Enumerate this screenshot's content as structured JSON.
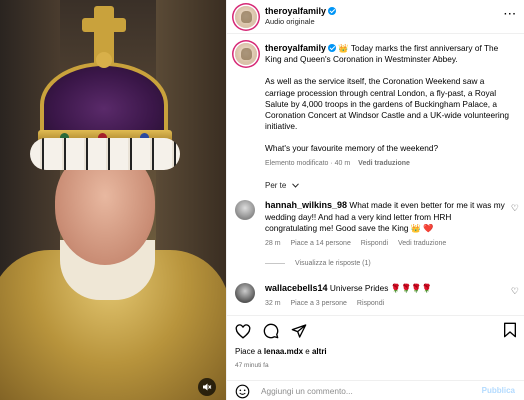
{
  "header": {
    "username": "theroyalfamily",
    "audio_label": "Audio originale",
    "more_icon": "more-horizontal-icon"
  },
  "caption": {
    "username": "theroyalfamily",
    "emoji": "👑",
    "text1": "Today marks the first anniversary of The King and Queen's Coronation in Westminster Abbey.",
    "text2": "As well as the service itself, the Coronation Weekend saw a carriage procession through central London, a fly-past, a Royal Salute by 4,000 troops in the gardens of Buckingham Palace, a Coronation Concert at Windsor Castle and a UK-wide volunteering initiative.",
    "text3": "What's your favourite memory of the weekend?",
    "edited": "Elemento modificato · 40 m",
    "translate": "Vedi traduzione"
  },
  "language_selector": "Per te",
  "comments": [
    {
      "username": "hannah_wilkins_98",
      "text": "What made it even better for me it was my wedding day!! And had a very kind letter from HRH congratulating me! Good save the King 👑 ❤️",
      "time": "28 m",
      "likes": "Piace a 14 persone",
      "reply": "Rispondi",
      "translate": "Vedi traduzione",
      "replies": "Visualizza le risposte (1)"
    },
    {
      "username": "wallacebells14",
      "text": "Universe Prides 🌹🌹🌹🌹",
      "time": "32 m",
      "likes": "Piace a 3 persone",
      "reply": "Rispondi"
    }
  ],
  "footer": {
    "likes_prefix": "Piace a",
    "likes_user": "lenaa.mdx",
    "likes_suffix": "e",
    "likes_others": "altri",
    "time": "47 minuti fa",
    "comment_placeholder": "Aggiungi un commento...",
    "publish": "Pubblica"
  },
  "colors": {
    "verified": "#0095f6",
    "story_ring": "#d62976",
    "muted_text": "#737373",
    "publish_disabled": "#b3dbff"
  }
}
